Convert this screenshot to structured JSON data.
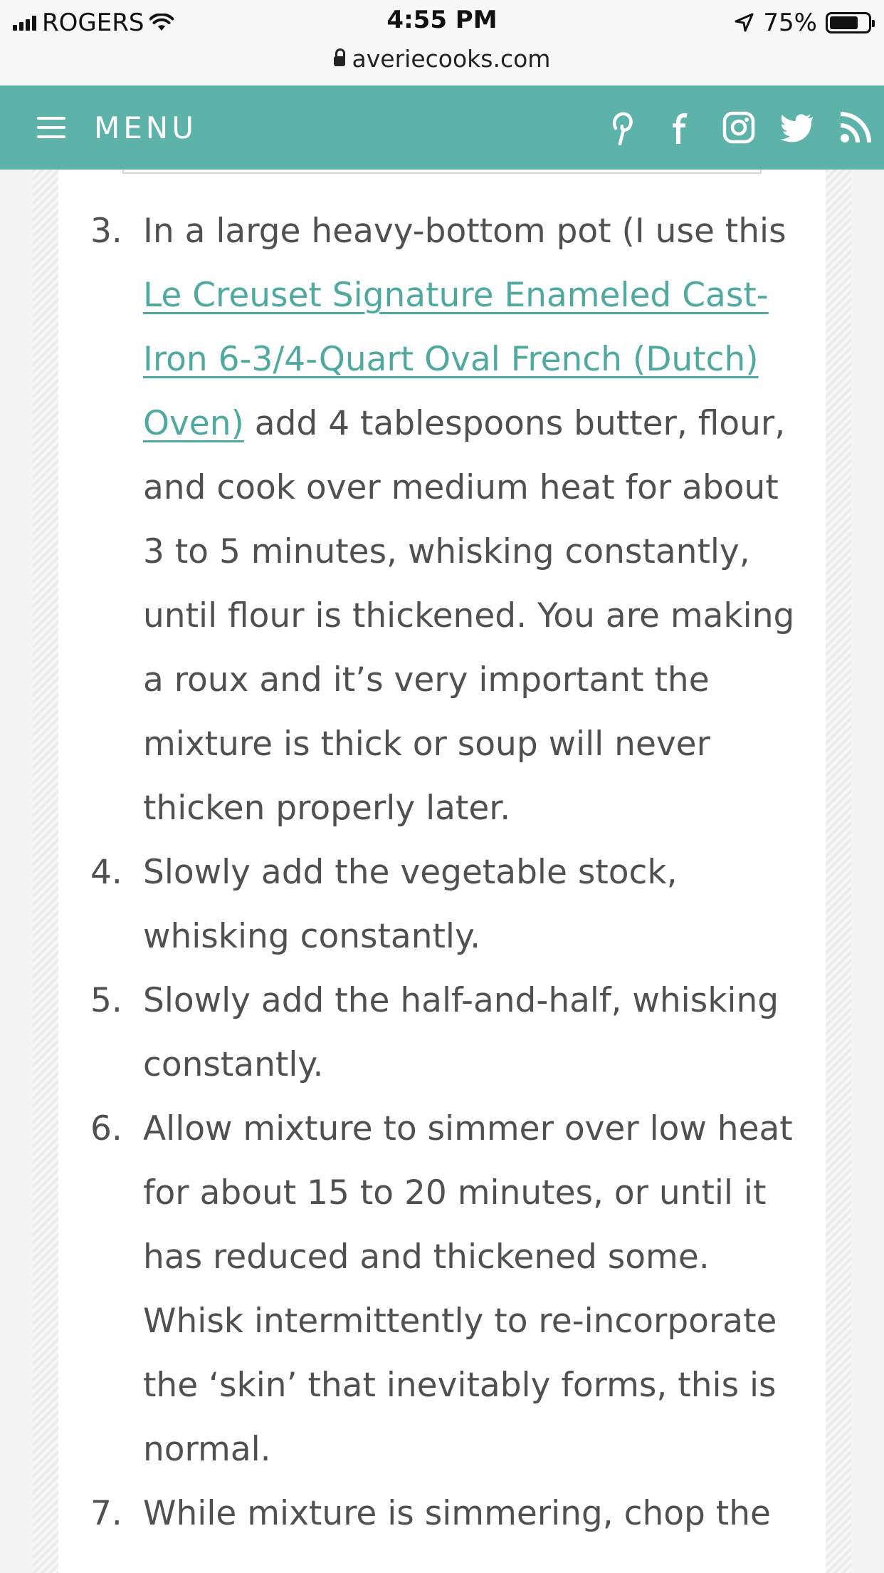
{
  "status_bar": {
    "carrier": "ROGERS",
    "time": "4:55 PM",
    "battery_percent": "75%",
    "battery_level": 0.75,
    "url": "averiecooks.com"
  },
  "nav": {
    "menu_label": "MENU",
    "background_color": "#5db3a9",
    "social_icons": [
      "pinterest-icon",
      "facebook-icon",
      "instagram-icon",
      "twitter-icon",
      "rss-icon"
    ]
  },
  "steps": [
    {
      "number": "3.",
      "text_before": "In a large heavy-bottom pot (I use this ",
      "link": "Le Creuset Signature Enameled Cast-Iron 6-3/4-Quart Oval French (Dutch) Oven)",
      "text_after": " add 4 tablespoons butter, flour, and cook over medium heat for about 3 to 5 minutes, whisking constantly, until flour is thickened. You are making a roux and it’s very important the mixture is thick or soup will never thicken properly later."
    },
    {
      "number": "4.",
      "text": "Slowly add the vegetable stock, whisking constantly."
    },
    {
      "number": "5.",
      "text": "Slowly add the half-and-half, whisking constantly."
    },
    {
      "number": "6.",
      "text": "Allow mixture to simmer over low heat for about 15 to 20 minutes, or until it has reduced and thickened some. Whisk intermittently to re-incorporate the ‘skin’ that inevitably forms, this is normal."
    },
    {
      "number": "7.",
      "text": "While mixture is simmering, chop the"
    }
  ]
}
